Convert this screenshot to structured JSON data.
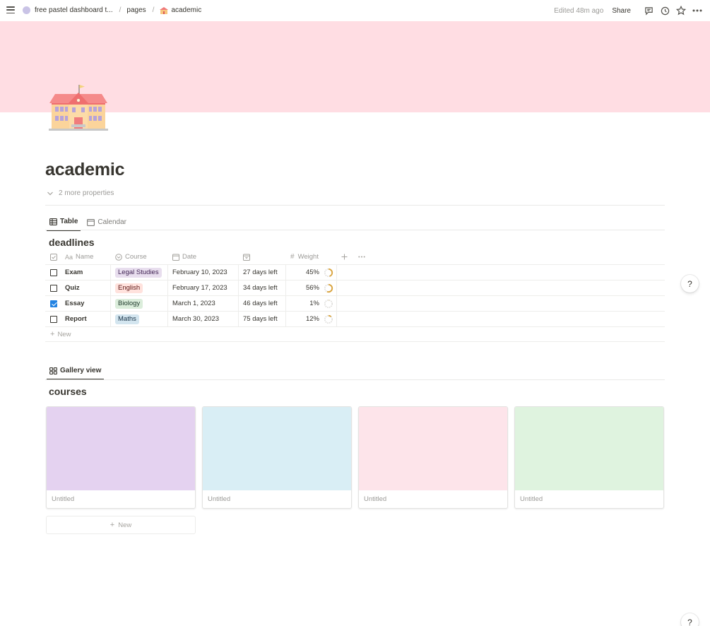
{
  "topbar": {
    "breadcrumbs": [
      "free pastel dashboard t...",
      "pages",
      "academic"
    ],
    "separator": "/",
    "edited": "Edited 48m ago",
    "share_label": "Share"
  },
  "page": {
    "title": "academic",
    "more_properties": "2 more properties",
    "cover_color": "#ffdde3"
  },
  "deadlines": {
    "tabs": [
      {
        "label": "Table",
        "icon": "table-icon",
        "active": true
      },
      {
        "label": "Calendar",
        "icon": "calendar-icon",
        "active": false
      }
    ],
    "title": "deadlines",
    "columns": {
      "name": "Name",
      "course": "Course",
      "date": "Date",
      "weight": "Weight"
    },
    "rows": [
      {
        "checked": false,
        "name": "Exam",
        "course": "Legal Studies",
        "course_bg": "#e8deee",
        "course_fg": "#412454",
        "date": "February 10, 2023",
        "days_left": "27 days left",
        "weight_label": "45%",
        "weight": 0.45
      },
      {
        "checked": false,
        "name": "Quiz",
        "course": "English",
        "course_bg": "#ffe2dd",
        "course_fg": "#5d1715",
        "date": "February 17, 2023",
        "days_left": "34 days left",
        "weight_label": "56%",
        "weight": 0.56
      },
      {
        "checked": true,
        "name": "Essay",
        "course": "Biology",
        "course_bg": "#dbeddb",
        "course_fg": "#1c3829",
        "date": "March 1, 2023",
        "days_left": "46 days left",
        "weight_label": "1%",
        "weight": 0.01
      },
      {
        "checked": false,
        "name": "Report",
        "course": "Maths",
        "course_bg": "#d3e5ef",
        "course_fg": "#183347",
        "date": "March 30, 2023",
        "days_left": "75 days left",
        "weight_label": "12%",
        "weight": 0.12
      }
    ],
    "new_label": "New"
  },
  "courses": {
    "tab_label": "Gallery view",
    "title": "courses",
    "cards": [
      {
        "title": "Untitled",
        "color": "#e4d2f0"
      },
      {
        "title": "Untitled",
        "color": "#d9eef5"
      },
      {
        "title": "Untitled",
        "color": "#fde4ea"
      },
      {
        "title": "Untitled",
        "color": "#dff3df"
      }
    ],
    "new_label": "New"
  },
  "help_label": "?"
}
